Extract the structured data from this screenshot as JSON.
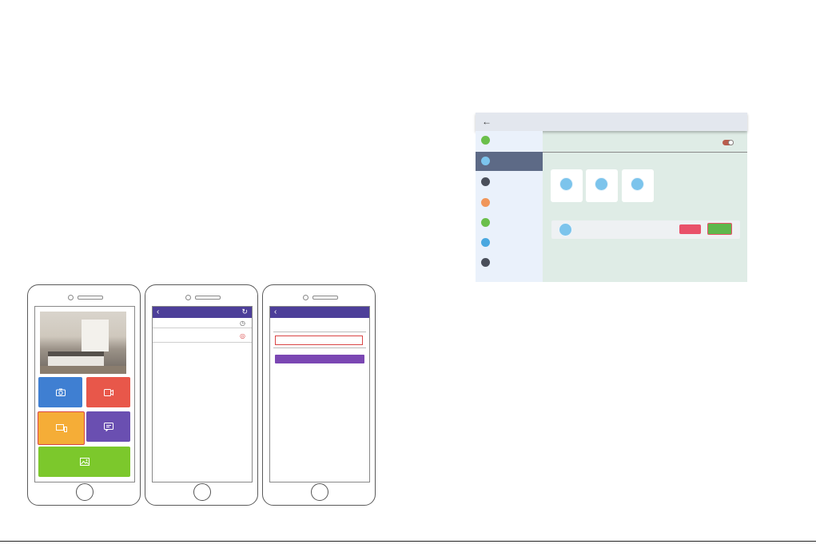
{
  "colors": {
    "phone_appbar": "#4d3f99",
    "tile_camera": "#3f7fd2",
    "tile_record": "#e8574a",
    "tile_devices": "#f5ad37",
    "tile_messages": "#6a4fb1",
    "tile_gallery": "#7cc82c",
    "purple_button": "#7b47b3",
    "highlight_border": "#d94545",
    "window_content_bg": "#dfece6",
    "sidebar_bg": "#eaf1fb",
    "sidebar_active": "#5d6a86",
    "avatar": "#7cc4ec",
    "delete_button": "#e9516a",
    "confirm_button": "#5fb74c"
  },
  "phone1": {
    "tiles": [
      {
        "name": "camera-tile",
        "icon": "camera-icon"
      },
      {
        "name": "record-tile",
        "icon": "video-icon"
      },
      {
        "name": "devices-tile",
        "icon": "devices-icon",
        "highlighted": true
      },
      {
        "name": "messages-tile",
        "icon": "message-icon"
      },
      {
        "name": "gallery-tile",
        "icon": "image-icon"
      }
    ]
  },
  "phone2": {
    "appbar": {
      "back_icon": "chevron-left-icon",
      "action_icon": "refresh-icon"
    },
    "rows": [
      {
        "icon": "clock-icon"
      },
      {
        "icon": "target-icon"
      }
    ]
  },
  "phone3": {
    "appbar": {
      "back_icon": "chevron-left-icon"
    }
  },
  "window": {
    "titlebar": {
      "back_icon": "arrow-left-icon"
    },
    "sidebar": [
      {
        "icon": "status-icon",
        "color": "#6abf4b",
        "active": false
      },
      {
        "icon": "user-icon",
        "color": "#7cc4ec",
        "active": true
      },
      {
        "icon": "monitor-icon",
        "color": "#4a4f5a",
        "active": false
      },
      {
        "icon": "wifi-icon",
        "color": "#f0965a",
        "active": false
      },
      {
        "icon": "calendar-icon",
        "color": "#6abf4b",
        "active": false
      },
      {
        "icon": "settings-icon",
        "color": "#4aa8e0",
        "active": false
      },
      {
        "icon": "info-icon",
        "color": "#4a4f5a",
        "active": false
      }
    ],
    "main": {
      "toggle_on": true,
      "user_cards": 3,
      "selected_user_actions": [
        "delete-button",
        "confirm-button"
      ]
    }
  }
}
